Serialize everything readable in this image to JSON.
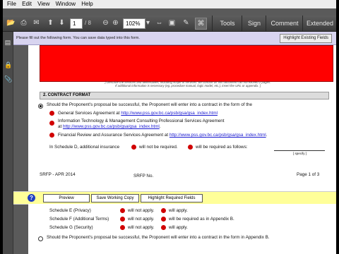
{
  "menu": [
    "File",
    "Edit",
    "View",
    "Window",
    "Help"
  ],
  "toolbar": {
    "page_current": "1",
    "page_total": "/ 8",
    "zoom": "102%",
    "tabs": [
      "Tools",
      "Sign",
      "Comment",
      "Extended"
    ]
  },
  "notice": {
    "text": "Please fill out the following form. You can save data typed into this form.",
    "highlight_button": "Highlight Existing Fields"
  },
  "doc": {
    "caption_line1": "[ Describe the services and deliverables, including scope of services. Be concise as this document can not exceed 2 pages.",
    "caption_line2": "If additional information is necessary (eg. procedure manual, logic model, etc.), insert the URL or appendix. ]",
    "section_title": "2.  CONTRACT FORMAT",
    "radio_text": "Should the Proponent's proposal be successful, the Proponent will enter into a contract in the form of the",
    "options": [
      {
        "text": "General Services Agreement at ",
        "link": "http://www.pss.gov.bc.ca/psb/gsa/gsa_index.html"
      },
      {
        "text": "Information Technology & Management Consulting Professional Services Agreement",
        "text2": "at ",
        "link": "http://www.pss.gov.bc.ca/psb/gsa/gsa_index.html",
        "suffix": "."
      },
      {
        "text": "Financial Review and Assurance Services Agreement at ",
        "link": "http://www.pss.gov.bc.ca/psb/gsa/gsa_index.html",
        "suffix": "."
      }
    ],
    "schedule_d_text": "In Schedule D, additional insurance",
    "will_not_be_required": "will not be required.",
    "will_be_required": "will be required as follows:",
    "specify": "[ specify ]",
    "footer_left": "SRFP - APR 2014",
    "footer_mid": "SRFP No.",
    "footer_right": "Page 1 of 3"
  },
  "yellow_bar": {
    "buttons": [
      "Preview",
      "Save Working Copy",
      "Highlight Required Fields"
    ]
  },
  "doc2": {
    "schedules": [
      {
        "label": "Schedule E (Privacy)",
        "opt1": "will not apply.",
        "opt2": "will apply."
      },
      {
        "label": "Schedule F (Additional Terms)",
        "opt1": "will not apply.",
        "opt2": "will be required as in Appendix B."
      },
      {
        "label": "Schedule G (Security)",
        "opt1": "will not apply.",
        "opt2": "will apply."
      }
    ],
    "bottom_text": "Should the Proponent's proposal be successful, the Proponent will enter into a contract in the form in Appendix B."
  }
}
